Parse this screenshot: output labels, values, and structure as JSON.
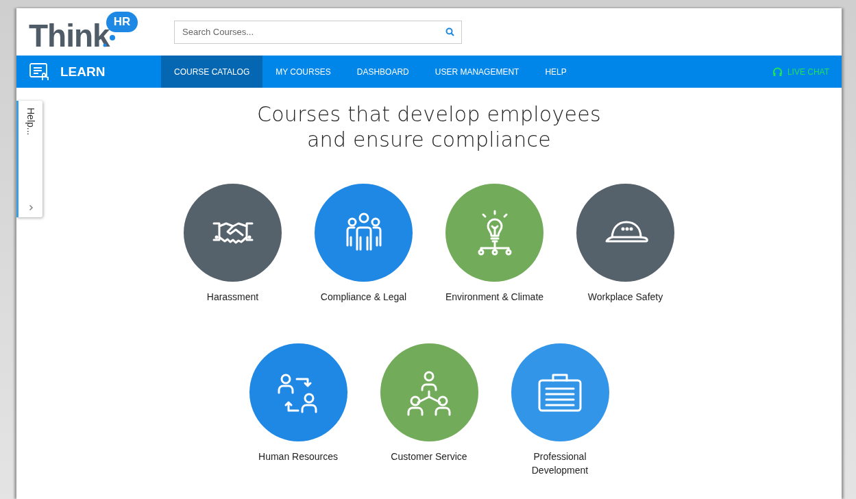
{
  "logo": {
    "text": "Think",
    "badge": "HR"
  },
  "search": {
    "placeholder": "Search Courses..."
  },
  "nav": {
    "brand": "LEARN",
    "items": [
      {
        "label": "COURSE CATALOG",
        "selected": true
      },
      {
        "label": "MY COURSES",
        "selected": false
      },
      {
        "label": "DASHBOARD",
        "selected": false
      },
      {
        "label": "USER MANAGEMENT",
        "selected": false
      },
      {
        "label": "HELP",
        "selected": false
      }
    ],
    "live_chat": "LIVE CHAT"
  },
  "help_tab": {
    "label": "Help..."
  },
  "heading": [
    "Courses that develop employees",
    "and ensure compliance"
  ],
  "category_rows": [
    [
      {
        "label": "Harassment",
        "color": "#56626b"
      },
      {
        "label": "Compliance & Legal",
        "color": "#1f88e5"
      },
      {
        "label": "Environment & Climate",
        "color": "#72ac5a"
      },
      {
        "label": "Workplace Safety",
        "color": "#56626b"
      }
    ],
    [
      {
        "label": "Human Resources",
        "color": "#1f88e5"
      },
      {
        "label": "Customer Service",
        "color": "#72ac5a"
      },
      {
        "label": "Professional\nDevelopment",
        "color": "#3395e8"
      }
    ]
  ]
}
